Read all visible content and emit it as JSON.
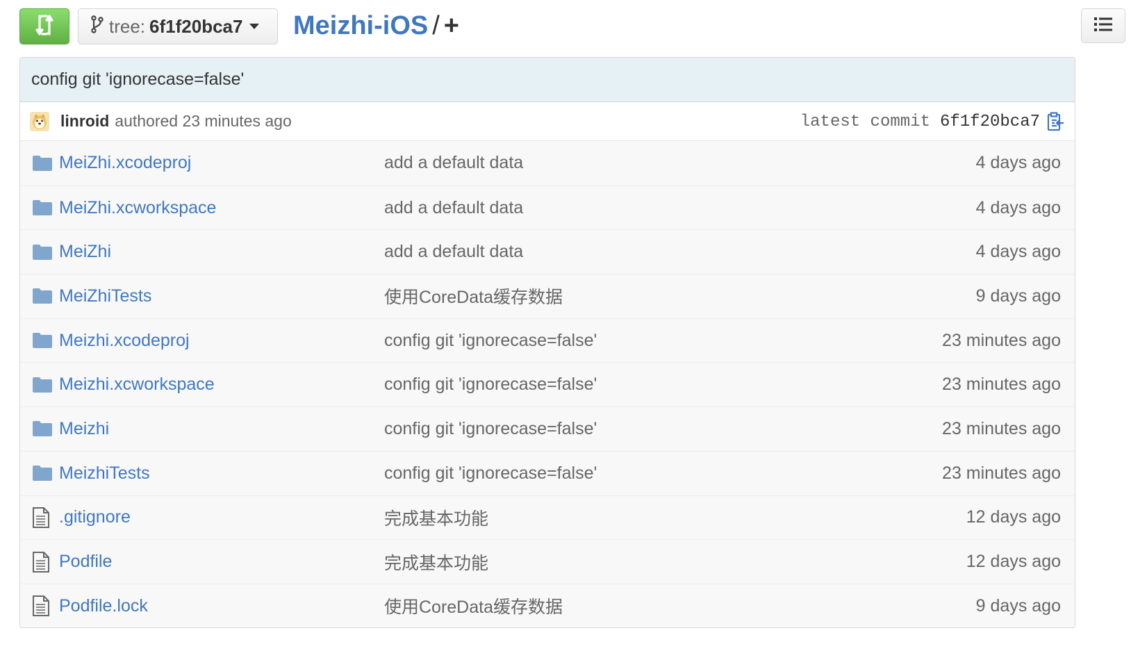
{
  "toolbar": {
    "branch_prefix": "tree:",
    "branch_name": "6f1f20bca7",
    "repo_name": "Meizhi-iOS",
    "path_separator": "/",
    "add_file": "+"
  },
  "commit": {
    "message": "config git 'ignorecase=false'",
    "author": "linroid",
    "authored_text": "authored 23 minutes ago",
    "latest_label": "latest commit",
    "sha": "6f1f20bca7"
  },
  "files": [
    {
      "name": "MeiZhi.xcodeproj",
      "type": "folder",
      "message": "add a default data",
      "age": "4 days ago"
    },
    {
      "name": "MeiZhi.xcworkspace",
      "type": "folder",
      "message": "add a default data",
      "age": "4 days ago"
    },
    {
      "name": "MeiZhi",
      "type": "folder",
      "message": "add a default data",
      "age": "4 days ago"
    },
    {
      "name": "MeiZhiTests",
      "type": "folder",
      "message": "使用CoreData缓存数据",
      "age": "9 days ago"
    },
    {
      "name": "Meizhi.xcodeproj",
      "type": "folder",
      "message": "config git 'ignorecase=false'",
      "age": "23 minutes ago"
    },
    {
      "name": "Meizhi.xcworkspace",
      "type": "folder",
      "message": "config git 'ignorecase=false'",
      "age": "23 minutes ago"
    },
    {
      "name": "Meizhi",
      "type": "folder",
      "message": "config git 'ignorecase=false'",
      "age": "23 minutes ago"
    },
    {
      "name": "MeizhiTests",
      "type": "folder",
      "message": "config git 'ignorecase=false'",
      "age": "23 minutes ago"
    },
    {
      "name": ".gitignore",
      "type": "file",
      "message": "完成基本功能",
      "age": "12 days ago"
    },
    {
      "name": "Podfile",
      "type": "file",
      "message": "完成基本功能",
      "age": "12 days ago"
    },
    {
      "name": "Podfile.lock",
      "type": "file",
      "message": "使用CoreData缓存数据",
      "age": "9 days ago"
    }
  ],
  "colors": {
    "link": "#4078c0",
    "compare_green": "#60b044",
    "commit_bg": "#e6f1f6",
    "folder_icon": "#80a6cd"
  },
  "icons": {
    "compare": "git-compare-icon",
    "branch": "git-branch-icon",
    "list": "list-icon",
    "clipboard": "clipboard-icon",
    "folder": "folder-icon",
    "file": "file-text-icon"
  }
}
